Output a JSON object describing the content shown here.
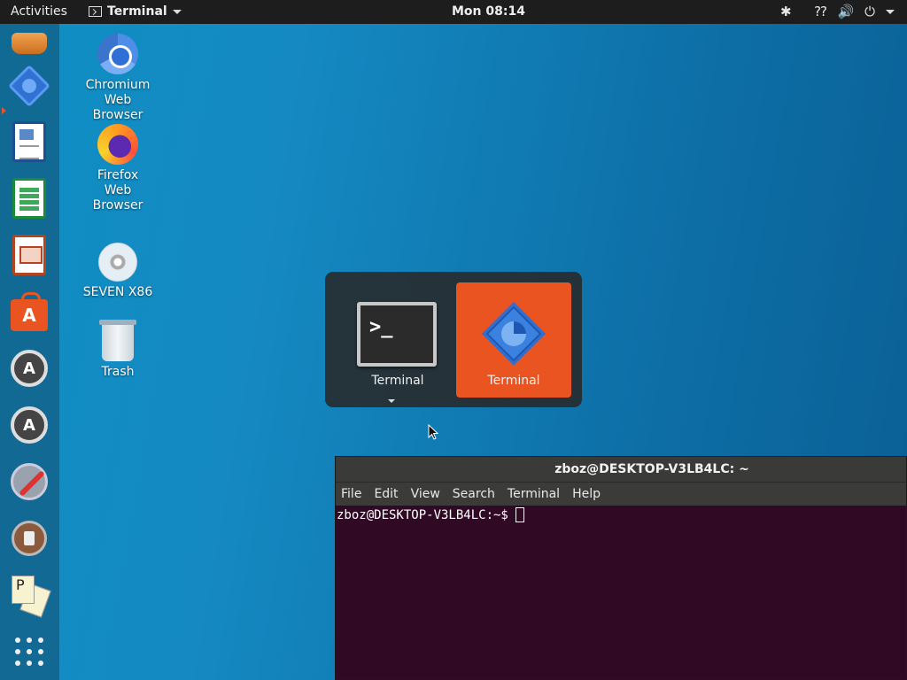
{
  "topbar": {
    "activities": "Activities",
    "app_menu_label": "Terminal",
    "clock": "Mon 08:14",
    "tray_icons": [
      "bluetooth-icon",
      "network-question-icon",
      "volume-icon",
      "power-icon",
      "chevron-down-icon"
    ]
  },
  "dock": {
    "items": [
      {
        "name": "ubuntu-installer-icon"
      },
      {
        "name": "bleachbit-gear-icon",
        "active": true
      },
      {
        "name": "libreoffice-writer-icon"
      },
      {
        "name": "libreoffice-calc-icon"
      },
      {
        "name": "libreoffice-impress-icon"
      },
      {
        "name": "ubuntu-software-icon"
      },
      {
        "name": "software-updater-icon"
      },
      {
        "name": "software-updater-icon-2"
      },
      {
        "name": "system-tools-icon"
      },
      {
        "name": "rescue-app-icon"
      },
      {
        "name": "solitaire-cards-icon"
      },
      {
        "name": "show-applications-icon"
      }
    ],
    "cards_letter": "P",
    "accent": "#e95420"
  },
  "desktop": {
    "icons": [
      {
        "label": "Chromium Web Browser"
      },
      {
        "label": "Firefox Web Browser"
      },
      {
        "label": "SEVEN X86"
      },
      {
        "label": "Trash"
      }
    ]
  },
  "switcher": {
    "items": [
      {
        "label": "Terminal",
        "selected": false
      },
      {
        "label": "Terminal",
        "selected": true
      }
    ],
    "term_glyph": ">_"
  },
  "terminal": {
    "title": "zboz@DESKTOP-V3LB4LC: ~",
    "menu": [
      "File",
      "Edit",
      "View",
      "Search",
      "Terminal",
      "Help"
    ],
    "prompt": "zboz@DESKTOP-V3LB4LC:~$",
    "background": "#300a24"
  }
}
